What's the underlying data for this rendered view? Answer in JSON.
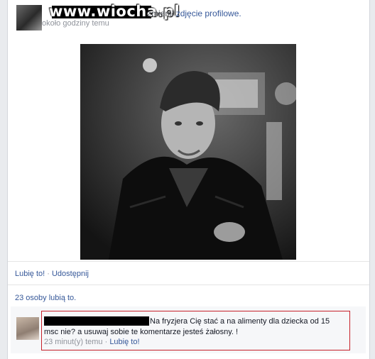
{
  "header": {
    "watermark": "www.wiocha.pl",
    "action_prefix": "zmienił ",
    "action_link": "zdjęcie profilowe.",
    "timestamp": "około godziny temu"
  },
  "actions": {
    "like": "Lubię to!",
    "separator": " · ",
    "share": "Udostępnij"
  },
  "likes_summary": "23 osoby lubią to.",
  "comment": {
    "text": "Na fryzjera Cię stać a na alimenty dla dziecka od 15 msc nie? a usuwaj sobie te komentarze jesteś żałosny. !",
    "time": "23 minut(y) temu",
    "separator": " · ",
    "like": "Lubię to!"
  },
  "colors": {
    "link": "#365899",
    "highlight_border": "#c7212a",
    "muted": "#90949c"
  }
}
